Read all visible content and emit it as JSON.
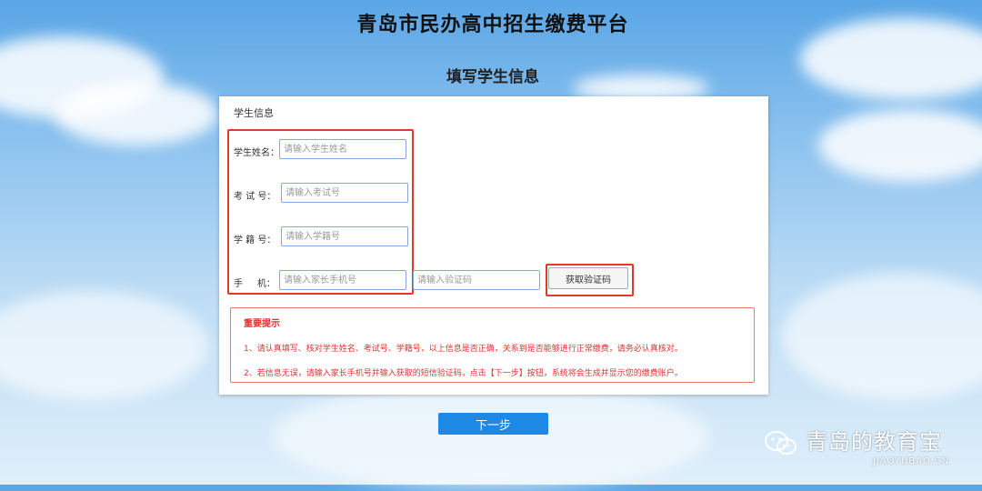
{
  "header": {
    "site_title": "青岛市民办高中招生缴费平台",
    "page_subtitle": "填写学生信息"
  },
  "form": {
    "section_title": "学生信息",
    "fields": [
      {
        "label": "学生姓名：",
        "placeholder": "请输入学生姓名"
      },
      {
        "label": "考 试 号：",
        "placeholder": "请输入考试号"
      },
      {
        "label": "学 籍 号：",
        "placeholder": "请输入学籍号"
      },
      {
        "label": "手     机：",
        "placeholder": "请输入家长手机号"
      }
    ],
    "code_placeholder": "请输入验证码",
    "get_code_label": "获取验证码"
  },
  "notice": {
    "title": "重要提示",
    "lines": [
      "1、请认真填写、核对学生姓名、考试号、学籍号，以上信息是否正确，关系到是否能够进行正常缴费，请务必认真核对。",
      "2、若信息无误，请输入家长手机号并输入获取的短信验证码，点击【下一步】按钮，系统将会生成并显示您的缴费账户。"
    ]
  },
  "actions": {
    "next_label": "下一步"
  },
  "watermark": {
    "text": "青岛的教育宝",
    "sub": "JIAOYUBAO.CN",
    "icon": "wechat-icon"
  },
  "colors": {
    "highlight_red": "#e03b2a",
    "notice_red": "#d33333",
    "primary_blue": "#1e88e5",
    "input_border": "#86a7d8"
  }
}
